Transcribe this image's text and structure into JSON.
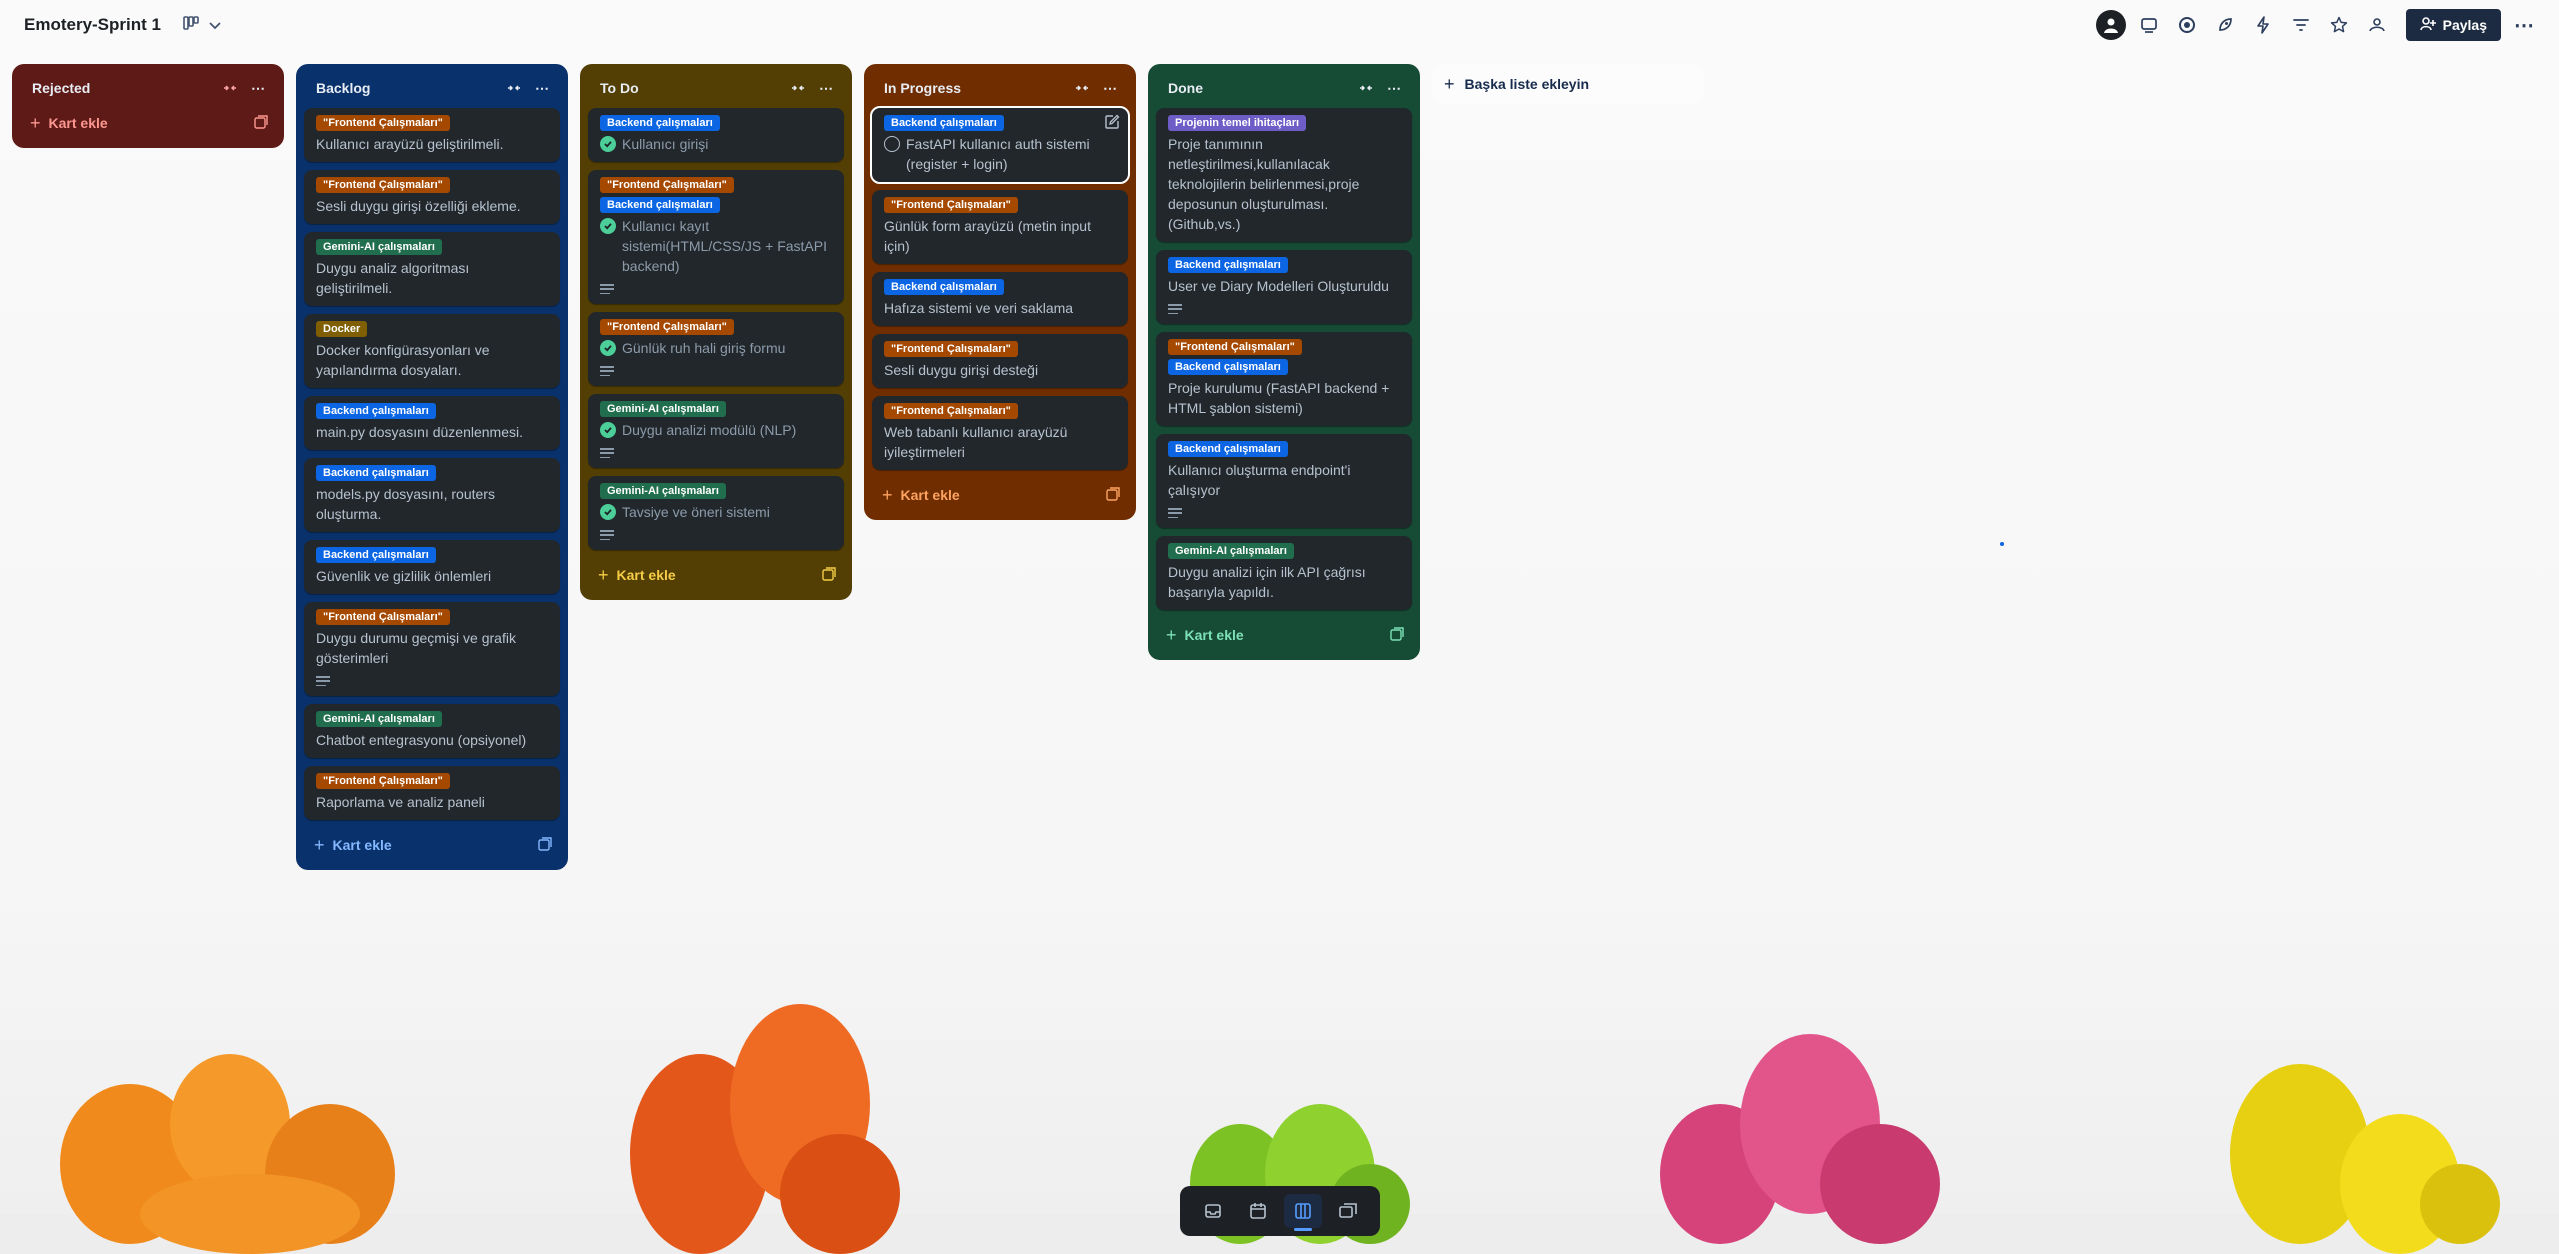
{
  "board": {
    "title": "Emotery-Sprint 1"
  },
  "header": {
    "share_label": "Paylaş"
  },
  "add_list_label": "Başka liste ekleyin",
  "lists": [
    {
      "id": "rejected",
      "title": "Rejected",
      "add_card_label": "Kart ekle",
      "cards": []
    },
    {
      "id": "backlog",
      "title": "Backlog",
      "add_card_label": "Kart ekle",
      "cards": [
        {
          "labels": [
            "\"Frontend Çalışmaları\""
          ],
          "title": "Kullanıcı arayüzü geliştirilmeli."
        },
        {
          "labels": [
            "\"Frontend Çalışmaları\""
          ],
          "title": "Sesli duygu girişi özelliği ekleme."
        },
        {
          "labels": [
            "Gemini-AI çalışmaları"
          ],
          "title": "Duygu analiz algoritması geliştirilmeli."
        },
        {
          "labels": [
            "Docker"
          ],
          "title": "Docker konfigürasyonları ve yapılandırma dosyaları."
        },
        {
          "labels": [
            "Backend çalışmaları"
          ],
          "title": "main.py dosyasını düzenlenmesi."
        },
        {
          "labels": [
            "Backend çalışmaları"
          ],
          "title": "models.py dosyasını, routers oluşturma."
        },
        {
          "labels": [
            "Backend çalışmaları"
          ],
          "title": "Güvenlik ve gizlilik önlemleri"
        },
        {
          "labels": [
            "\"Frontend Çalışmaları\""
          ],
          "title": "Duygu durumu geçmişi ve grafik gösterimleri",
          "has_description": true
        },
        {
          "labels": [
            "Gemini-AI çalışmaları"
          ],
          "title": "Chatbot entegrasyonu (opsiyonel)"
        },
        {
          "labels": [
            "\"Frontend Çalışmaları\""
          ],
          "title": "Raporlama ve analiz paneli"
        }
      ]
    },
    {
      "id": "todo",
      "title": "To Do",
      "add_card_label": "Kart ekle",
      "cards": [
        {
          "labels": [
            "Backend çalışmaları"
          ],
          "title": "Kullanıcı girişi",
          "complete": true
        },
        {
          "labels": [
            "\"Frontend Çalışmaları\"",
            "Backend çalışmaları"
          ],
          "title": "Kullanıcı kayıt sistemi(HTML/CSS/JS + FastAPI backend)",
          "complete": true,
          "has_description": true
        },
        {
          "labels": [
            "\"Frontend Çalışmaları\""
          ],
          "title": "Günlük ruh hali giriş formu",
          "complete": true,
          "has_description": true
        },
        {
          "labels": [
            "Gemini-AI çalışmaları"
          ],
          "title": "Duygu analizi modülü (NLP)",
          "complete": true,
          "has_description": true
        },
        {
          "labels": [
            "Gemini-AI çalışmaları"
          ],
          "title": "Tavsiye ve öneri sistemi",
          "complete": true,
          "has_description": true
        }
      ]
    },
    {
      "id": "progress",
      "title": "In Progress",
      "add_card_label": "Kart ekle",
      "cards": [
        {
          "labels": [
            "Backend çalışmaları"
          ],
          "title": "FastAPI kullanıcı auth sistemi (register + login)",
          "open_check": true,
          "active": true
        },
        {
          "labels": [
            "\"Frontend Çalışmaları\""
          ],
          "title": "Günlük form arayüzü (metin input için)"
        },
        {
          "labels": [
            "Backend çalışmaları"
          ],
          "title": "Hafıza sistemi ve veri saklama"
        },
        {
          "labels": [
            "\"Frontend Çalışmaları\""
          ],
          "title": "Sesli duygu girişi desteği"
        },
        {
          "labels": [
            "\"Frontend Çalışmaları\""
          ],
          "title": "Web tabanlı kullanıcı arayüzü iyileştirmeleri"
        }
      ]
    },
    {
      "id": "done",
      "title": "Done",
      "add_card_label": "Kart ekle",
      "cards": [
        {
          "labels": [
            "Projenin temel ihitaçları"
          ],
          "title": "Proje tanımının netleştirilmesi,kullanılacak teknolojilerin belirlenmesi,proje deposunun oluşturulması.(Github,vs.)"
        },
        {
          "labels": [
            "Backend çalışmaları"
          ],
          "title": "User ve Diary Modelleri Oluşturuldu",
          "has_description": true
        },
        {
          "labels": [
            "\"Frontend Çalışmaları\"",
            "Backend çalışmaları"
          ],
          "title": "Proje kurulumu (FastAPI backend + HTML şablon sistemi)"
        },
        {
          "labels": [
            "Backend çalışmaları"
          ],
          "title": "Kullanıcı oluşturma endpoint'i çalışıyor",
          "has_description": true
        },
        {
          "labels": [
            "Gemini-AI çalışmaları"
          ],
          "title": "Duygu analizi için ilk API çağrısı başarıyla yapıldı."
        }
      ]
    }
  ]
}
